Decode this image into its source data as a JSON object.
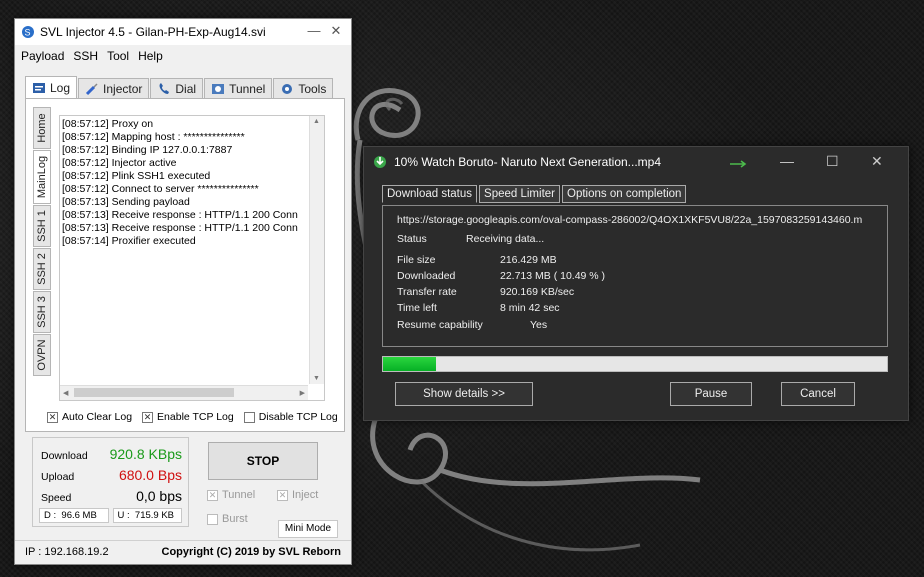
{
  "svl": {
    "title": "SVL Injector 4.5 - Gilan-PH-Exp-Aug14.svi",
    "window_controls": {
      "minimize": "—",
      "close": "✕"
    },
    "menu": [
      "Payload",
      "SSH",
      "Tool",
      "Help"
    ],
    "tabs": [
      {
        "label": "Log",
        "icon": "log-icon"
      },
      {
        "label": "Injector",
        "icon": "syringe-icon"
      },
      {
        "label": "Dial",
        "icon": "phone-icon"
      },
      {
        "label": "Tunnel",
        "icon": "tunnel-icon"
      },
      {
        "label": "Tools",
        "icon": "gear-icon"
      }
    ],
    "side_tabs": [
      "Home",
      "MainLog",
      "SSH 1",
      "SSH 2",
      "SSH 3",
      "OVPN"
    ],
    "log_lines": [
      "[08:57:12] Proxy on",
      "[08:57:12] Mapping host : ***************",
      "[08:57:12] Binding IP 127.0.0.1:7887",
      "[08:57:12] Injector active",
      "[08:57:12] Plink SSH1 executed",
      "[08:57:12] Connect to server ***************",
      "[08:57:13] Sending payload",
      "[08:57:13] Receive response : HTTP/1.1 200 Conn",
      "[08:57:13] Receive response : HTTP/1.1 200 Conn",
      "[08:57:14] Proxifier executed"
    ],
    "checks": [
      {
        "label": "Auto Clear Log",
        "checked": true
      },
      {
        "label": "Enable TCP Log",
        "checked": true
      },
      {
        "label": "Disable TCP Log",
        "checked": false
      }
    ],
    "stats": {
      "download_label": "Download",
      "download_value": "920.8 KBps",
      "download_color": "#1a9a1a",
      "upload_label": "Upload",
      "upload_value": "680.0 Bps",
      "upload_color": "#d01010",
      "speed_label": "Speed",
      "speed_value": "0,0 bps",
      "d_label": "D :",
      "d_value": "96.6 MB",
      "u_label": "U :",
      "u_value": "715.9 KB"
    },
    "stop_label": "STOP",
    "options": [
      {
        "label": "Tunnel",
        "checked": true
      },
      {
        "label": "Inject",
        "checked": true
      },
      {
        "label": "Burst",
        "checked": false
      }
    ],
    "mini_mode_label": "Mini Mode",
    "ip_text": "IP : 192.168.19.2",
    "copyright": "Copyright (C) 2019 by SVL Reborn"
  },
  "download": {
    "title": "10% Watch Boruto- Naruto Next Generation...mp4",
    "tabs": [
      "Download status",
      "Speed Limiter",
      "Options on completion"
    ],
    "url": "https://storage.googleapis.com/oval-compass-286002/Q4OX1XKF5VU8/22a_1597083259143460.m",
    "status_label": "Status",
    "status_value": "Receiving data...",
    "rows": [
      {
        "label": "File size",
        "value": "216.429  MB"
      },
      {
        "label": "Downloaded",
        "value": "22.713  MB  ( 10.49 % )"
      },
      {
        "label": "Transfer rate",
        "value": "920.169  KB/sec"
      },
      {
        "label": "Time left",
        "value": "8 min 42 sec"
      },
      {
        "label": "Resume capability",
        "value": "Yes"
      }
    ],
    "progress_fraction": 0.1049,
    "buttons": {
      "details": "Show details >>",
      "pause": "Pause",
      "cancel": "Cancel"
    }
  }
}
